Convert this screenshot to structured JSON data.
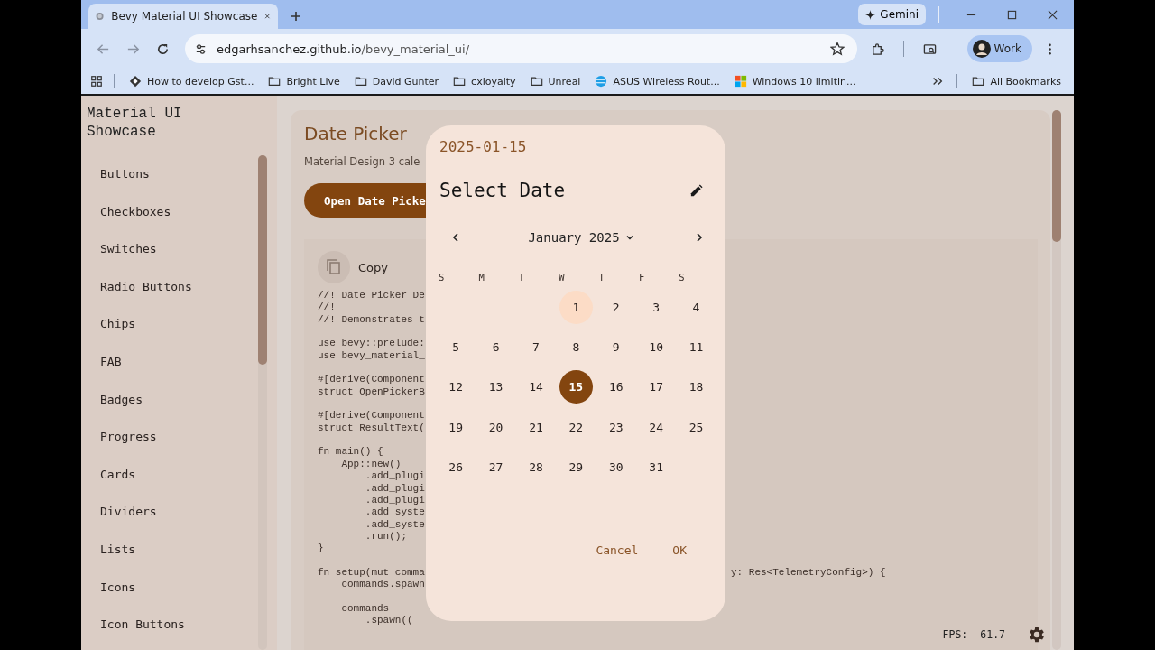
{
  "browser": {
    "tab": {
      "title": "Bevy Material UI Showcase"
    },
    "address": {
      "host": "edgarhsanchez.github.io",
      "path": "/bevy_material_ui/"
    },
    "gemini": "Gemini",
    "profile": "Work",
    "bookmarks": [
      {
        "label": "How to develop Gst...",
        "kind": "diamond"
      },
      {
        "label": "Bright Live",
        "kind": "folder"
      },
      {
        "label": "David Gunter",
        "kind": "folder"
      },
      {
        "label": "cxloyalty",
        "kind": "folder"
      },
      {
        "label": "Unreal",
        "kind": "folder"
      },
      {
        "label": "ASUS Wireless Rout...",
        "kind": "globe"
      },
      {
        "label": "Windows 10 limitin...",
        "kind": "tiles"
      }
    ],
    "all_bookmarks": "All Bookmarks"
  },
  "sidebar": {
    "title": "Material UI Showcase",
    "items": [
      {
        "label": "Buttons",
        "selected": false
      },
      {
        "label": "Checkboxes",
        "selected": false
      },
      {
        "label": "Switches",
        "selected": false
      },
      {
        "label": "Radio Buttons",
        "selected": false
      },
      {
        "label": "Chips",
        "selected": false
      },
      {
        "label": "FAB",
        "selected": false
      },
      {
        "label": "Badges",
        "selected": false
      },
      {
        "label": "Progress",
        "selected": false
      },
      {
        "label": "Cards",
        "selected": false
      },
      {
        "label": "Dividers",
        "selected": false
      },
      {
        "label": "Lists",
        "selected": false
      },
      {
        "label": "Icons",
        "selected": false
      },
      {
        "label": "Icon Buttons",
        "selected": false
      }
    ]
  },
  "section": {
    "title": "Date Picker",
    "subtitle": "Material Design 3 cale",
    "button": "Open Date Picke",
    "copy": "Copy",
    "code": [
      {
        "kind": "text",
        "left": "//! Date Picker De"
      },
      {
        "kind": "text",
        "left": "//!"
      },
      {
        "kind": "text",
        "left": "//! Demonstrates t"
      },
      {
        "kind": "blank"
      },
      {
        "kind": "text",
        "left": "use bevy::prelude:"
      },
      {
        "kind": "text",
        "left": "use bevy_material_"
      },
      {
        "kind": "blank"
      },
      {
        "kind": "text",
        "left": "#[derive(Component"
      },
      {
        "kind": "text",
        "left": "struct OpenPickerB"
      },
      {
        "kind": "blank"
      },
      {
        "kind": "text",
        "left": "#[derive(Component"
      },
      {
        "kind": "text",
        "left": "struct ResultText("
      },
      {
        "kind": "blank"
      },
      {
        "kind": "text",
        "left": "fn main() {"
      },
      {
        "kind": "text",
        "left": "    App::new()"
      },
      {
        "kind": "text",
        "left": "        .add_plugi"
      },
      {
        "kind": "text",
        "left": "        .add_plugi"
      },
      {
        "kind": "text",
        "left": "        .add_plugi"
      },
      {
        "kind": "text",
        "left": "        .add_syste"
      },
      {
        "kind": "text",
        "left": "        .add_syste"
      },
      {
        "kind": "text",
        "left": "        .run();"
      },
      {
        "kind": "text",
        "left": "}"
      },
      {
        "kind": "blank"
      },
      {
        "kind": "text",
        "left": "fn setup(mut comma",
        "right": "y: Res<TelemetryConfig>) {"
      },
      {
        "kind": "text",
        "left": "    commands.spawn"
      },
      {
        "kind": "blank"
      },
      {
        "kind": "text",
        "left": "    commands"
      },
      {
        "kind": "text",
        "left": "        .spawn(("
      }
    ],
    "fps_label": "FPS:",
    "fps_value": "61.7"
  },
  "dialog": {
    "date": "2025-01-15",
    "title": "Select Date",
    "month": "January 2025",
    "weekdays": [
      "S",
      "M",
      "T",
      "W",
      "T",
      "F",
      "S"
    ],
    "weeks": [
      {
        "kind": "lead",
        "days": [
          {
            "label": "1",
            "selected": false,
            "today": true
          },
          {
            "label": "2",
            "selected": false,
            "today": false
          },
          {
            "label": "3",
            "selected": false,
            "today": false
          },
          {
            "label": "4",
            "selected": false,
            "today": false
          }
        ]
      },
      {
        "kind": "full",
        "days": [
          {
            "label": "5",
            "selected": false,
            "today": false
          },
          {
            "label": "6",
            "selected": false,
            "today": false
          },
          {
            "label": "7",
            "selected": false,
            "today": false
          },
          {
            "label": "8",
            "selected": false,
            "today": false
          },
          {
            "label": "9",
            "selected": false,
            "today": false
          },
          {
            "label": "10",
            "selected": false,
            "today": false
          },
          {
            "label": "11",
            "selected": false,
            "today": false
          }
        ]
      },
      {
        "kind": "full",
        "days": [
          {
            "label": "12",
            "selected": false,
            "today": false
          },
          {
            "label": "13",
            "selected": false,
            "today": false
          },
          {
            "label": "14",
            "selected": false,
            "today": false
          },
          {
            "label": "15",
            "selected": true,
            "today": false
          },
          {
            "label": "16",
            "selected": false,
            "today": false
          },
          {
            "label": "17",
            "selected": false,
            "today": false
          },
          {
            "label": "18",
            "selected": false,
            "today": false
          }
        ]
      },
      {
        "kind": "full",
        "days": [
          {
            "label": "19",
            "selected": false,
            "today": false
          },
          {
            "label": "20",
            "selected": false,
            "today": false
          },
          {
            "label": "21",
            "selected": false,
            "today": false
          },
          {
            "label": "22",
            "selected": false,
            "today": false
          },
          {
            "label": "23",
            "selected": false,
            "today": false
          },
          {
            "label": "24",
            "selected": false,
            "today": false
          },
          {
            "label": "25",
            "selected": false,
            "today": false
          }
        ]
      },
      {
        "kind": "full",
        "days": [
          {
            "label": "26",
            "selected": false,
            "today": false
          },
          {
            "label": "27",
            "selected": false,
            "today": false
          },
          {
            "label": "28",
            "selected": false,
            "today": false
          },
          {
            "label": "29",
            "selected": false,
            "today": false
          },
          {
            "label": "30",
            "selected": false,
            "today": false
          },
          {
            "label": "31",
            "selected": false,
            "today": false
          }
        ]
      }
    ],
    "buttons": [
      "Cancel",
      "OK"
    ]
  }
}
